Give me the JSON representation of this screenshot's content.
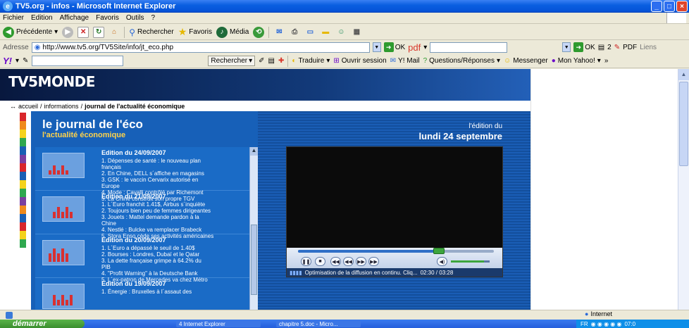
{
  "window": {
    "title": "TV5.org - infos - Microsoft Internet Explorer"
  },
  "menu": [
    "Fichier",
    "Edition",
    "Affichage",
    "Favoris",
    "Outils",
    "?"
  ],
  "toolbar": {
    "back": "Précédente",
    "search": "Rechercher",
    "favorites": "Favoris",
    "media": "Média"
  },
  "address": {
    "label": "Adresse",
    "url": "http://www.tv5.org/TV5Site/info/jt_eco.php",
    "go": "OK",
    "pdf": "pdf",
    "go2": "OK",
    "count": "2",
    "pdf_btn": "PDF",
    "links": "Liens"
  },
  "yahoo": {
    "logo": "Y!",
    "search_btn": "Rechercher",
    "translate": "Traduire",
    "session": "Ouvrir session",
    "mail": "Y! Mail",
    "qa": "Questions/Réponses",
    "messenger": "Messenger",
    "myyahoo": "Mon Yahoo!"
  },
  "site": {
    "logo": "TV5MONDE",
    "breadcrumb": {
      "home": "accueil",
      "section": "informations",
      "sep": "/",
      "current": "journal de l'actualité économique"
    },
    "journal_title": "le journal de l'éco",
    "journal_subtitle": "l'actualité économique",
    "edition_label": "l'édition du",
    "edition_date": "lundi 24 septembre"
  },
  "editions": [
    {
      "date": "Edition du 24/09/2007",
      "lines": [
        "1. Dépenses de santé : le nouveau plan",
        "français",
        "2. En Chine, DELL s´affiche en magasins",
        "3. GSK : le vaccin Cervarix autorisé en",
        "Europe",
        "4. Mode : Cavalli contrôlé par Richemont",
        "5. La Chine construit son propre TGV"
      ]
    },
    {
      "date": "Edition du 21/09/2007",
      "lines": [
        "1. L´Euro franchit 1.41$, Airbus s´inquiète",
        "2. Toujours bien peu de femmes dirigeantes",
        "3. Jouets : Mattel demande pardon à la",
        "Chine",
        "4. Nestlé : Bulcke va remplacer Brabeck",
        "5. Stora Enso cède ses activités américaines"
      ]
    },
    {
      "date": "Edition du 20/09/2007",
      "lines": [
        "1. L´Euro a dépassé le seuil de 1.40$",
        "2. Bourses : Londres, Dubaï et le Qatar",
        "3. La dette française grimpe à 64.2% du",
        "PIB",
        "4. \"Profit Warning\" à la Deutsche Bank",
        "5. L´ex-patron de Mercedes va chez Métro"
      ]
    },
    {
      "date": "Edition du 19/09/2007",
      "lines": [
        "1. Énergie : Bruxelles à l´assaut des"
      ]
    }
  ],
  "player": {
    "status": "Optimisation de la diffusion en continu. Cliq...",
    "time": "02:30 / 03:28",
    "progress": 0.72,
    "volume": 0.85
  },
  "statusbar": {
    "zone": "Internet"
  },
  "taskbar": {
    "start": "démarrer",
    "tasks": [
      "4 Internet Explorer",
      "chapitre 5.doc - Micro..."
    ],
    "lang": "FR",
    "clock": "07:0"
  },
  "colors": {
    "brand_bar": [
      "#d9262b",
      "#f08a1c",
      "#f4d21c",
      "#2fa84f",
      "#1a5fb4",
      "#7a3fa0",
      "#d9262b",
      "#1a5fb4",
      "#f4d21c",
      "#2fa84f",
      "#7a3fa0",
      "#f08a1c",
      "#1a5fb4",
      "#d9262b",
      "#f4d21c",
      "#2fa84f"
    ]
  }
}
